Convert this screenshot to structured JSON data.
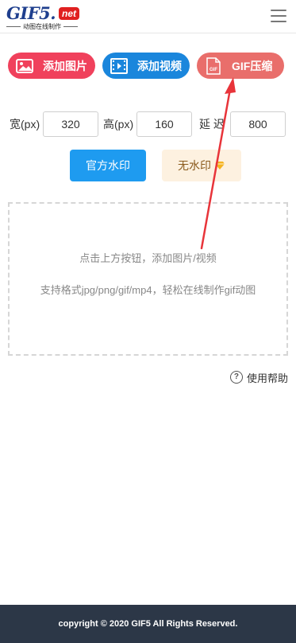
{
  "header": {
    "logo_text": "GIF5.",
    "logo_badge": "net",
    "logo_subtitle": "动图在线制作"
  },
  "actions": {
    "add_image": "添加图片",
    "add_video": "添加视频",
    "gif_compress": "GIF压缩",
    "gif_icon_text": "GIF"
  },
  "size": {
    "width_label": "宽(px)",
    "width_value": "320",
    "height_label": "高(px)",
    "height_value": "160",
    "delay_label": "延 迟",
    "delay_value": "800"
  },
  "watermark": {
    "official_label": "官方水印",
    "none_label": "无水印"
  },
  "drop_area": {
    "hint_primary": "点击上方按钮，添加图片/视频",
    "hint_secondary": "支持格式jpg/png/gif/mp4，轻松在线制作gif动图"
  },
  "help": {
    "label": "使用帮助"
  },
  "footer": {
    "copyright": "copyright © 2020 GIF5 All Rights Reserved."
  },
  "colors": {
    "add_image_bg": "#f0415c",
    "add_video_bg": "#1a86dc",
    "gif_compress_bg": "#e96e6b",
    "watermark_official_bg": "#1e9bf0",
    "watermark_none_bg": "#fdf1e0",
    "footer_bg": "#2c3747",
    "annotation_arrow": "#e8343a"
  }
}
